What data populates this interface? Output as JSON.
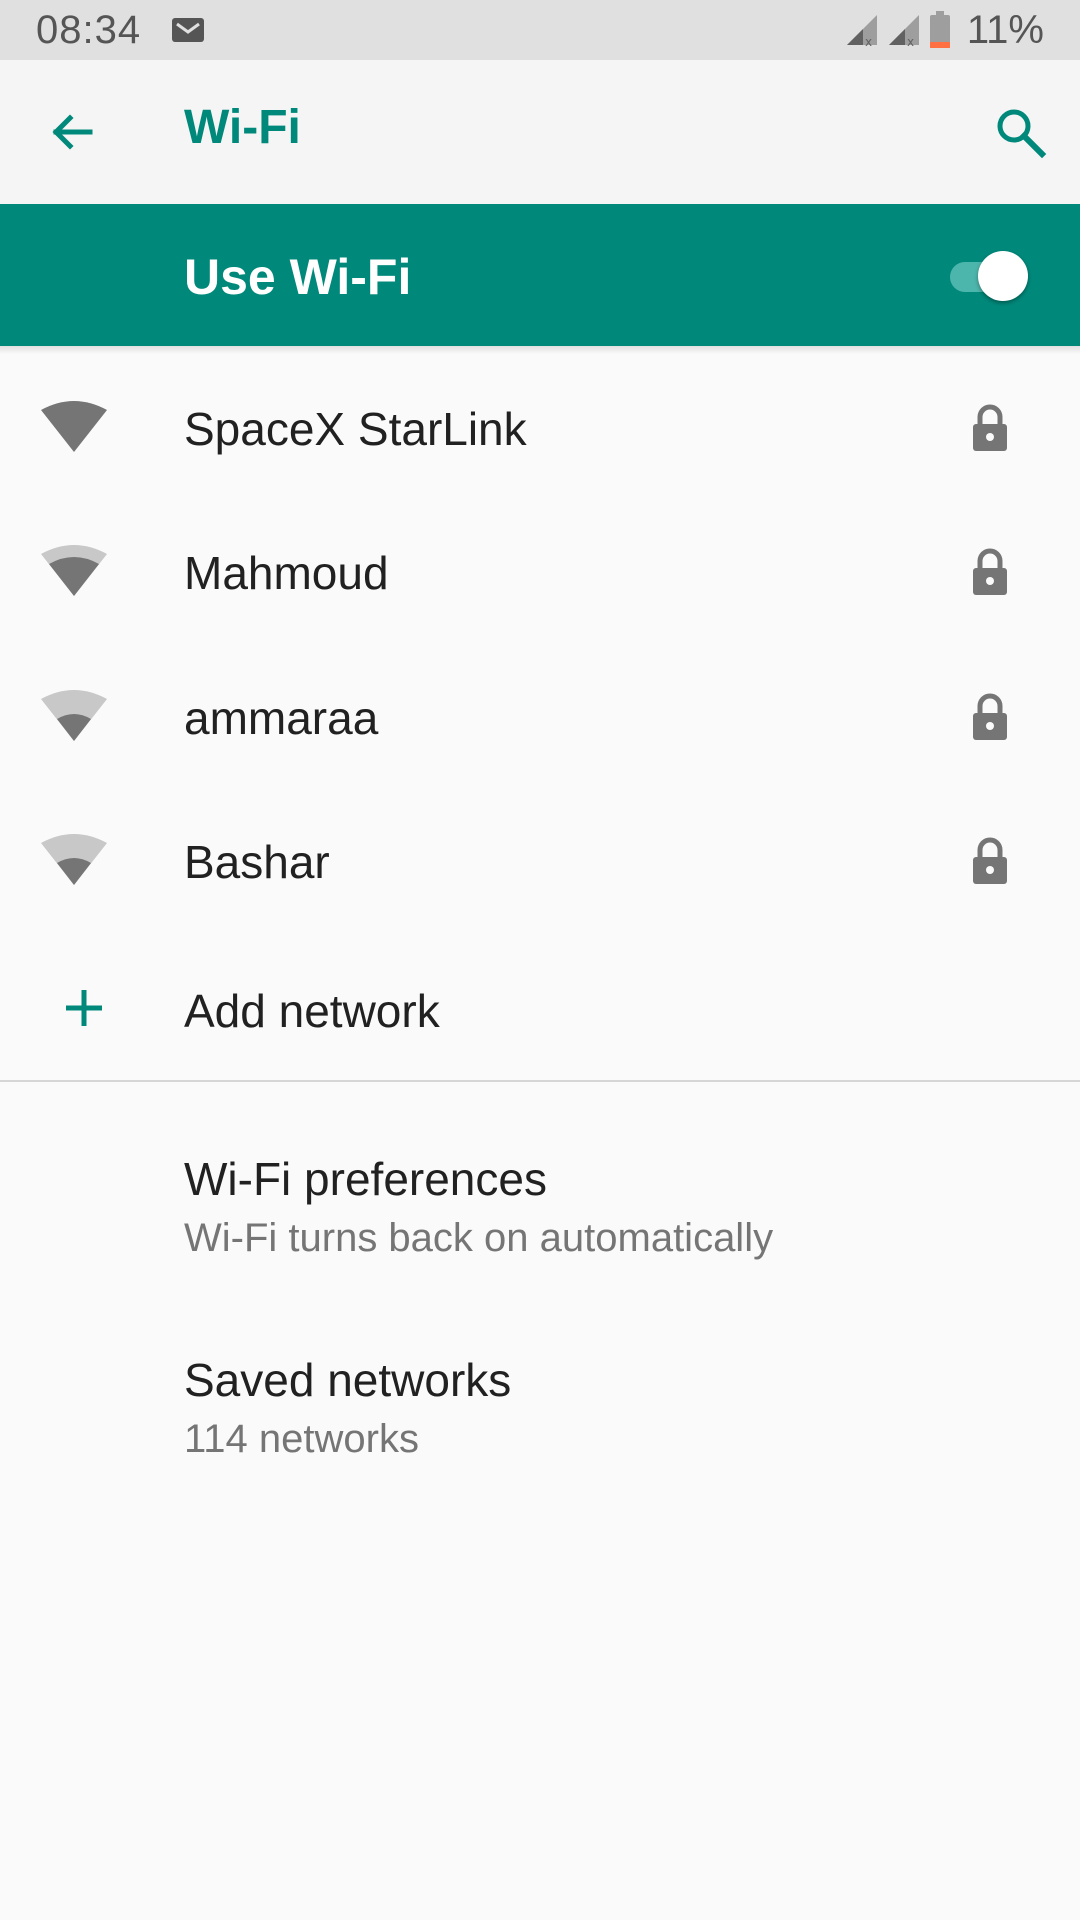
{
  "status_bar": {
    "time": "08:34",
    "battery": "11%",
    "icons": [
      "gmail-icon",
      "signal-icon",
      "signal-icon",
      "battery-icon"
    ]
  },
  "app_bar": {
    "title": "Wi-Fi",
    "back_icon": "arrow-back-icon",
    "search_icon": "search-icon"
  },
  "master_switch": {
    "label": "Use Wi-Fi",
    "enabled": true
  },
  "networks": [
    {
      "name": "SpaceX StarLink",
      "signal_level": 4,
      "secured": true
    },
    {
      "name": "Mahmoud",
      "signal_level": 3,
      "secured": true
    },
    {
      "name": "ammaraa",
      "signal_level": 2,
      "secured": true
    },
    {
      "name": "Bashar",
      "signal_level": 2,
      "secured": true
    }
  ],
  "add_network": {
    "label": "Add network",
    "icon": "plus-icon"
  },
  "preferences": [
    {
      "title": "Wi-Fi preferences",
      "summary": "Wi-Fi turns back on automatically"
    },
    {
      "title": "Saved networks",
      "summary": "114 networks"
    }
  ],
  "colors": {
    "accent": "#00897b",
    "accent_light": "#4db6ac",
    "status_bar_bg": "#e0e0e0",
    "background": "#fafafa",
    "battery_low": "#ff7043"
  }
}
